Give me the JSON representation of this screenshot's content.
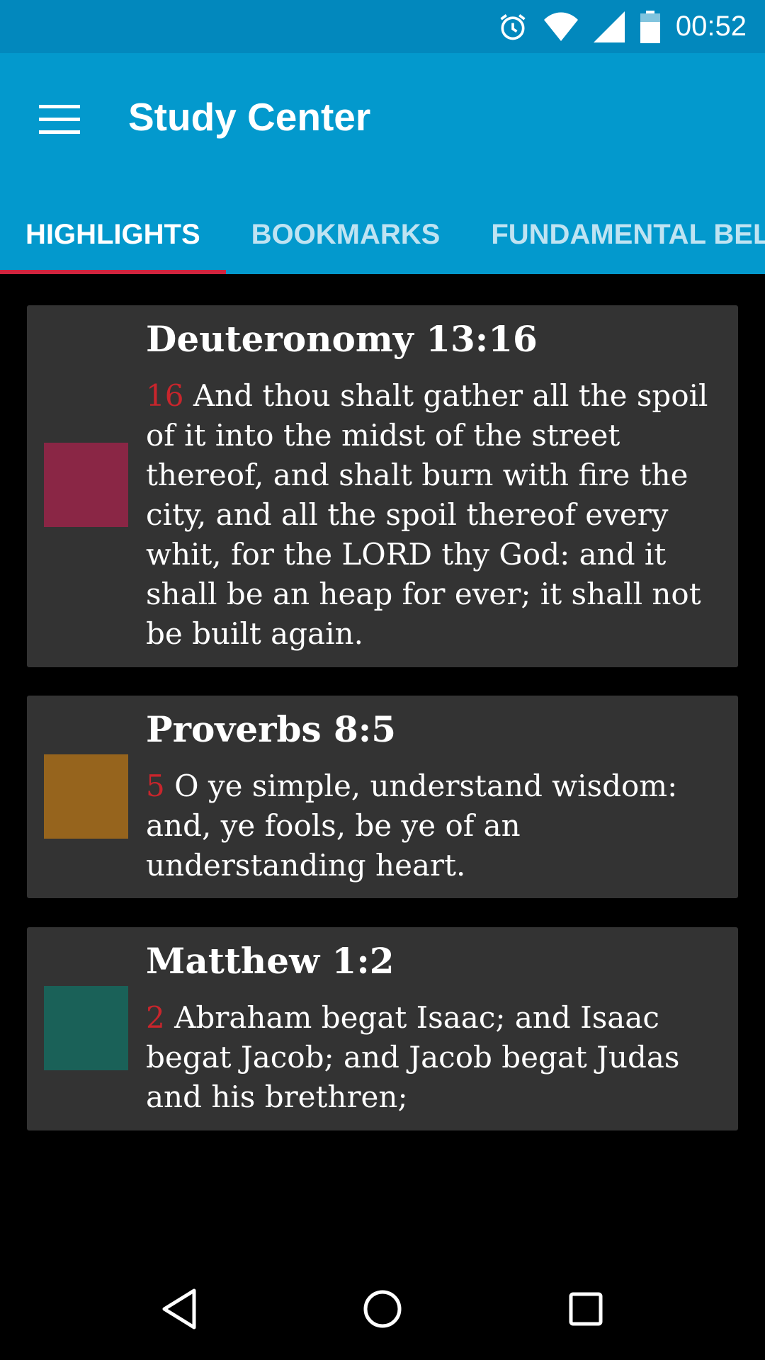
{
  "status_bar": {
    "time": "00:52",
    "icons": [
      "alarm-icon",
      "wifi-icon",
      "signal-icon",
      "battery-icon"
    ]
  },
  "app_bar": {
    "title": "Study Center",
    "menu_icon": "hamburger-menu-icon"
  },
  "tabs": [
    {
      "label": "HIGHLIGHTS",
      "active": true
    },
    {
      "label": "BOOKMARKS",
      "active": false
    },
    {
      "label": "FUNDAMENTAL BELIEFS",
      "active": false
    }
  ],
  "highlights": [
    {
      "reference": "Deuteronomy 13:16",
      "verse_number": "16",
      "text": "And thou shalt gather all the spoil of it into the midst of the street thereof, and shalt burn with fire the city, and all the spoil thereof every whit, for the LORD thy God: and it shall be an heap for ever; it shall not be built again.",
      "color": "#8a2645"
    },
    {
      "reference": "Proverbs 8:5",
      "verse_number": "5",
      "text": "O ye simple, understand wisdom: and, ye fools, be ye of an understanding heart.",
      "color": "#96641d"
    },
    {
      "reference": "Matthew 1:2",
      "verse_number": "2",
      "text": "Abraham begat Isaac; and Isaac begat Jacob; and Jacob begat Judas and his brethren;",
      "color": "#1a6158"
    }
  ],
  "nav_bar": {
    "icons": [
      "back-icon",
      "home-icon",
      "recents-icon"
    ]
  },
  "colors": {
    "status_bar": "#0288bd",
    "app_bar": "#0399cd",
    "tab_indicator": "#d0243e",
    "card": "#333333",
    "verse_number": "#c9252c"
  }
}
